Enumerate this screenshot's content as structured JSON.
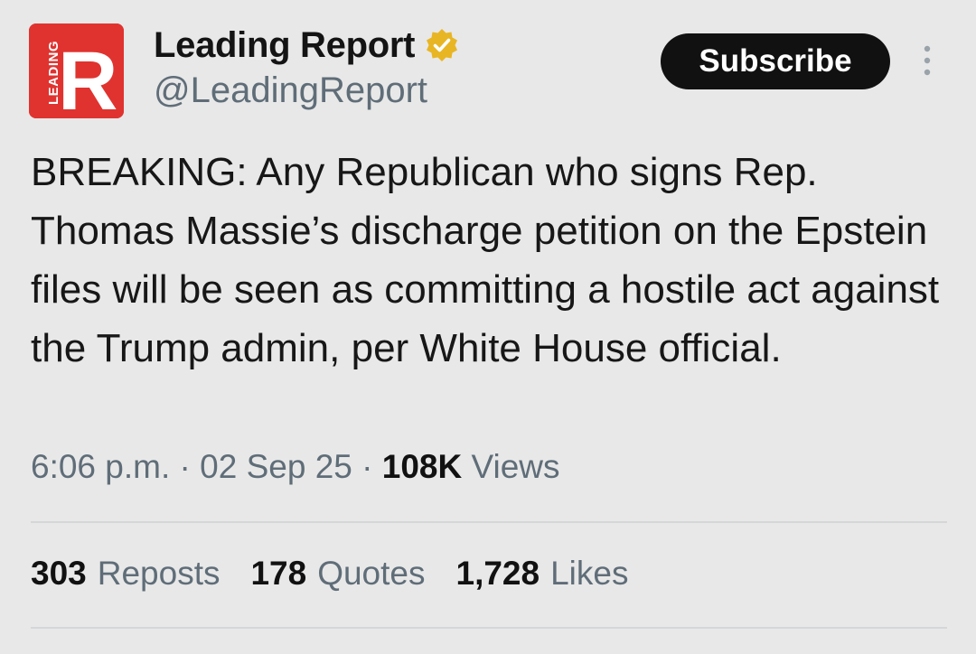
{
  "author": {
    "display_name": "Leading Report",
    "handle": "@LeadingReport",
    "avatar_letter": "R",
    "avatar_side_text": "LEADING",
    "avatar_color": "#e0332f",
    "verified_badge_color": "#e8b524"
  },
  "subscribe_label": "Subscribe",
  "tweet": {
    "text": "BREAKING: Any Republican who signs Rep. Thomas Massie’s discharge petition on the Epstein files will be seen as committing a hostile act against the Trump admin, per White House official."
  },
  "meta": {
    "time": "6:06 p.m.",
    "sep1": " · ",
    "date": "02 Sep 25",
    "sep2": " · ",
    "views_count": "108K",
    "views_label": " Views"
  },
  "stats": {
    "reposts_count": "303",
    "reposts_label": "Reposts",
    "quotes_count": "178",
    "quotes_label": "Quotes",
    "likes_count": "1,728",
    "likes_label": "Likes"
  },
  "icons": {
    "verified": "verified-badge-icon",
    "more": "more-vertical-icon"
  }
}
